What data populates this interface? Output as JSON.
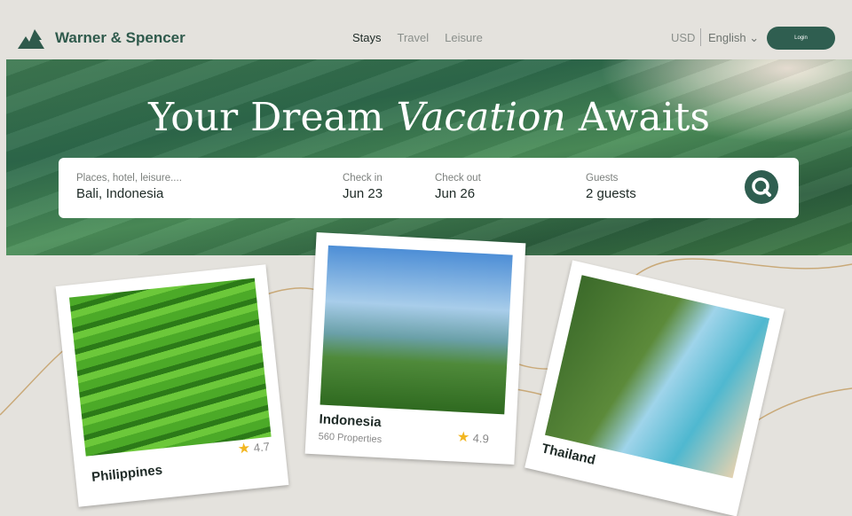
{
  "brand": {
    "name": "Warner & Spencer"
  },
  "nav": {
    "links": [
      "Stays",
      "Travel",
      "Leisure"
    ],
    "currency": "USD",
    "language": "English",
    "login": "Login"
  },
  "hero": {
    "title_start": "Your Dream",
    "title_script": "Vacation",
    "title_end": "Awaits"
  },
  "search": {
    "place": {
      "label": "Places, hotel, leisure....",
      "value": "Bali, Indonesia"
    },
    "checkin": {
      "label": "Check in",
      "value": "Jun 23"
    },
    "checkout": {
      "label": "Check out",
      "value": "Jun 26"
    },
    "guests": {
      "label": "Guests",
      "value": "2 guests"
    }
  },
  "cards": [
    {
      "name": "Philippines",
      "rating": "4.7"
    },
    {
      "name": "Indonesia",
      "properties": "560 Properties",
      "rating": "4.9"
    },
    {
      "name": "Thailand"
    }
  ],
  "colors": {
    "accent": "#2f5e50",
    "background": "#e4e2dd",
    "star": "#f2b620"
  }
}
